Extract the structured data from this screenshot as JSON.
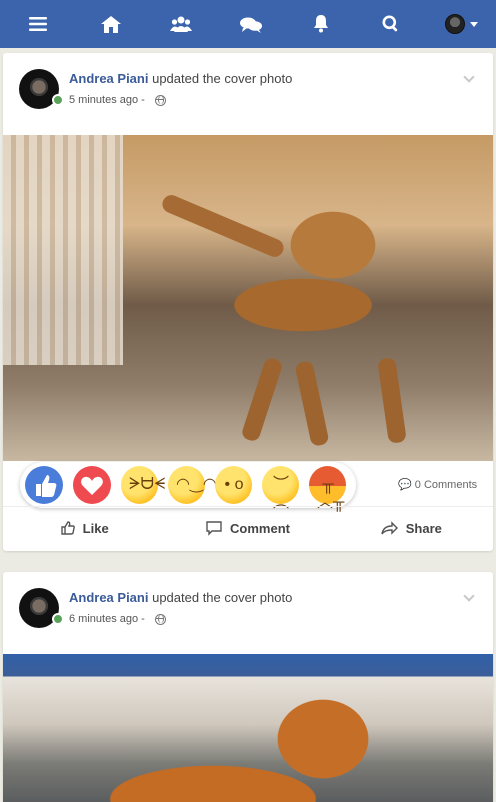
{
  "nav": {
    "menu_icon": "menu-icon",
    "home_icon": "home-icon",
    "friends_icon": "friends-icon",
    "messages_icon": "messages-icon",
    "notifications_icon": "bell-icon",
    "search_icon": "search-icon"
  },
  "posts": [
    {
      "author": "Andrea Piani",
      "action": "updated the cover photo",
      "time": "5 minutes ago -",
      "comments": "0 Comments"
    },
    {
      "author": "Andrea Piani",
      "action": "updated the cover photo",
      "time": "6 minutes ago -"
    }
  ],
  "actions": {
    "like": "Like",
    "comment": "Comment",
    "share": "Share"
  },
  "reactions": [
    "like",
    "love",
    "haha",
    "yay",
    "wow",
    "sad",
    "angry"
  ],
  "colors": {
    "accent": "#3b64ad",
    "author": "#3b5b98",
    "online": "#5aa35a"
  }
}
